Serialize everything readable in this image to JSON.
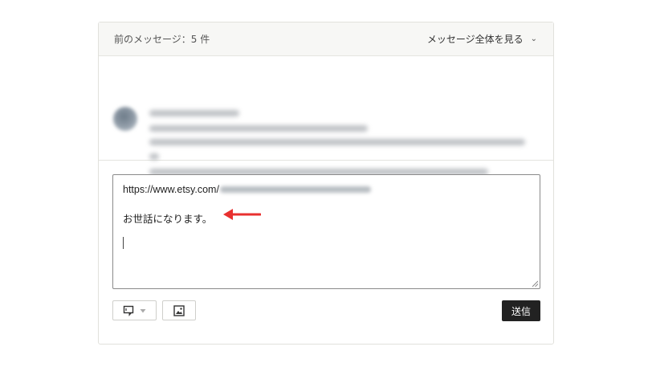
{
  "header": {
    "previous_messages": "前のメッセージ：5 件",
    "view_all": "メッセージ全体を見る"
  },
  "compose": {
    "url_prefix": "https://www.etsy.com/",
    "greeting": "お世話になります。"
  },
  "actions": {
    "send_label": "送信"
  },
  "colors": {
    "arrow": "#e8302f",
    "send_button_bg": "#222222"
  },
  "icons": [
    "chevron-down-icon",
    "snippet-icon",
    "caret-down-icon",
    "image-icon",
    "red-arrow-annotation"
  ]
}
